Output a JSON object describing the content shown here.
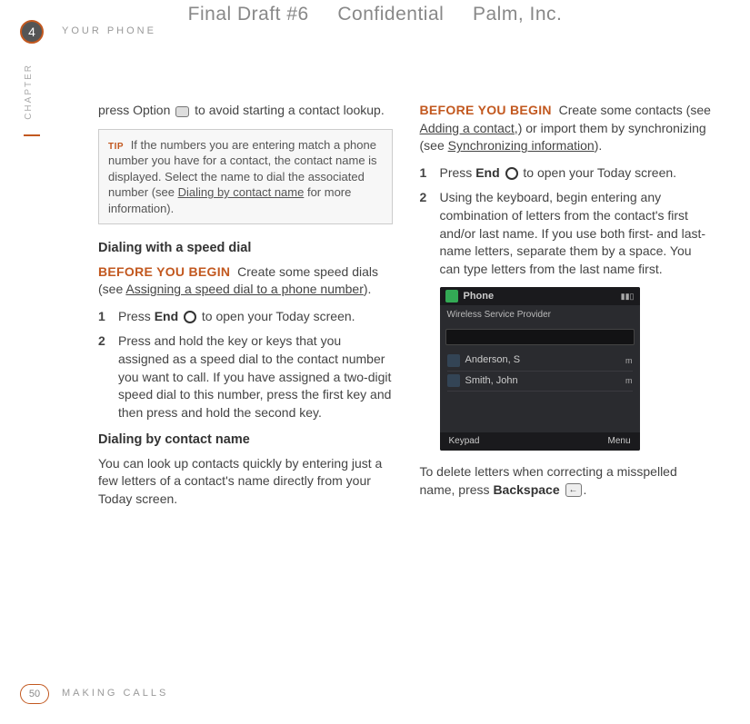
{
  "header": {
    "draft": "Final Draft #6",
    "confidential": "Confidential",
    "company": "Palm, Inc."
  },
  "chapter": {
    "number": "4",
    "label": "CHAPTER",
    "section_top": "YOUR PHONE"
  },
  "footer": {
    "page": "50",
    "section": "MAKING CALLS"
  },
  "left": {
    "intro_a": "press Option ",
    "intro_b": " to avoid starting a contact lookup.",
    "tip_label": "TIP",
    "tip_a": "If the numbers you are entering match a phone number you have for a contact, the contact name is displayed. Select the name to dial the associated number (see ",
    "tip_link": "Dialing by contact name",
    "tip_b": " for more information).",
    "h1": "Dialing with a speed dial",
    "byb": "BEFORE YOU BEGIN",
    "byb_body_a": "Create some speed dials (see ",
    "byb_link": "Assigning a speed dial to a phone number",
    "byb_body_b": ").",
    "steps": [
      {
        "n": "1",
        "a": "Press ",
        "bold": "End",
        "b": " to open your Today screen.",
        "hasEnd": true
      },
      {
        "n": "2",
        "a": "Press and hold the key or keys that you assigned as a speed dial to the contact number you want to call. If you have assigned a two-digit speed dial to this number, press the first key and then press and hold the second key.",
        "bold": "",
        "b": "",
        "hasEnd": false
      }
    ],
    "h2": "Dialing by contact name",
    "p2": "You can look up contacts quickly by entering just a few letters of a contact's name directly from your Today screen."
  },
  "right": {
    "byb": "BEFORE YOU BEGIN",
    "byb_a": "Create some contacts (see ",
    "byb_link1": "Adding a contact,",
    "byb_b": ") or import them by synchronizing (see ",
    "byb_link2": "Synchronizing information",
    "byb_c": ").",
    "steps": [
      {
        "n": "1",
        "a": "Press ",
        "bold": "End",
        "b": " to open your Today screen.",
        "hasEnd": true
      },
      {
        "n": "2",
        "a": "Using the keyboard, begin entering any combination of letters from the contact's first and/or last name. If you use both first- and last-name letters, separate them by a space. You can type letters from the last name first.",
        "bold": "",
        "b": "",
        "hasEnd": false
      }
    ],
    "screenshot": {
      "app": "Phone",
      "provider": "Wireless Service Provider",
      "rows": [
        {
          "name": "Anderson, S",
          "tag": "m"
        },
        {
          "name": "Smith, John",
          "tag": "m"
        }
      ],
      "left_soft": "Keypad",
      "right_soft": "Menu"
    },
    "tail_a": "To delete letters when correcting a misspelled name, press ",
    "tail_bold": "Backspace",
    "tail_b": "."
  }
}
